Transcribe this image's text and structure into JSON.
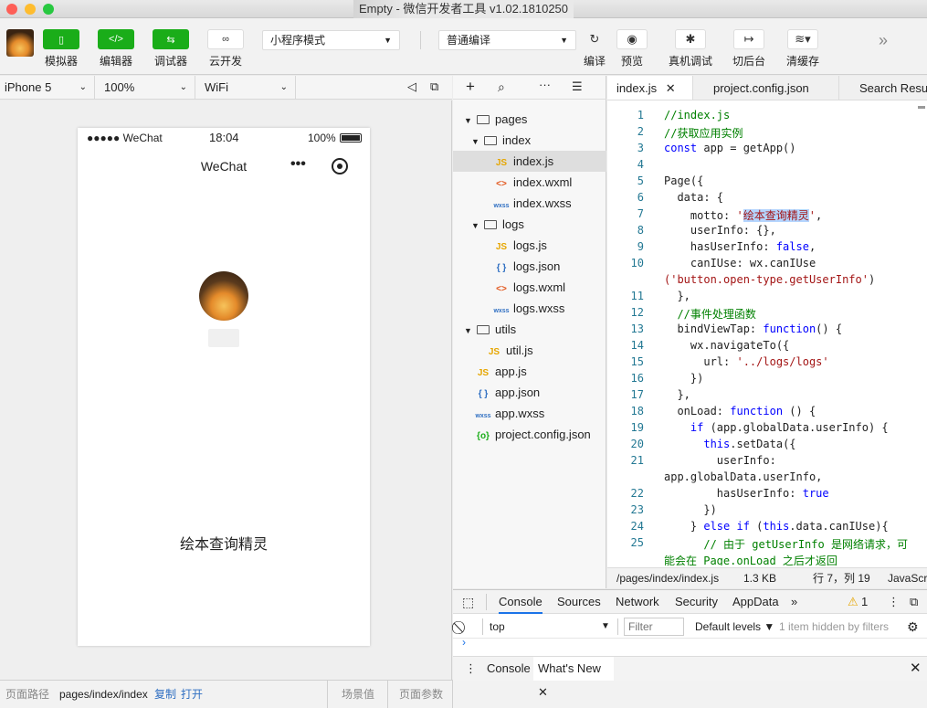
{
  "window": {
    "title": "Empty - 微信开发者工具 v1.02.1810250"
  },
  "toolbar": {
    "simulator": "模拟器",
    "editor": "编辑器",
    "debugger": "调试器",
    "cloud": "云开发",
    "mode_select": "小程序模式",
    "compile_select": "普通编译",
    "compile": "编译",
    "preview": "预览",
    "real_debug": "真机调试",
    "background": "切后台",
    "clear_cache": "清缓存"
  },
  "simbar": {
    "device": "iPhone 5",
    "zoom": "100%",
    "network": "WiFi"
  },
  "phone": {
    "carrier": "●●●●● WeChat",
    "time": "18:04",
    "battery": "100%",
    "nav_title": "WeChat",
    "motto": "绘本查询精灵"
  },
  "bottombar": {
    "path_label": "页面路径",
    "path": "pages/index/index",
    "copy": "复制",
    "open": "打开",
    "scene": "场景值",
    "params": "页面参数"
  },
  "filetree": [
    {
      "name": "pages",
      "type": "folder",
      "depth": 0
    },
    {
      "name": "index",
      "type": "folder",
      "depth": 1
    },
    {
      "name": "index.js",
      "type": "js",
      "depth": 2,
      "selected": true
    },
    {
      "name": "index.wxml",
      "type": "wxml",
      "depth": 2
    },
    {
      "name": "index.wxss",
      "type": "wxss",
      "depth": 2
    },
    {
      "name": "logs",
      "type": "folder",
      "depth": 1
    },
    {
      "name": "logs.js",
      "type": "js",
      "depth": 2
    },
    {
      "name": "logs.json",
      "type": "json",
      "depth": 2
    },
    {
      "name": "logs.wxml",
      "type": "wxml",
      "depth": 2
    },
    {
      "name": "logs.wxss",
      "type": "wxss",
      "depth": 2
    },
    {
      "name": "utils",
      "type": "folder",
      "depth": 0
    },
    {
      "name": "util.js",
      "type": "js",
      "depth": 1
    },
    {
      "name": "app.js",
      "type": "js",
      "depth": 0
    },
    {
      "name": "app.json",
      "type": "json",
      "depth": 0
    },
    {
      "name": "app.wxss",
      "type": "wxss",
      "depth": 0
    },
    {
      "name": "project.config.json",
      "type": "cfg",
      "depth": 0
    }
  ],
  "editor": {
    "tabs": [
      "index.js",
      "project.config.json",
      "Search Results"
    ],
    "status_path": "/pages/index/index.js",
    "status_size": "1.3 KB",
    "status_pos": "行 7，列 19",
    "status_lang": "JavaScript"
  },
  "devtools": {
    "tabs": [
      "Console",
      "Sources",
      "Network",
      "Security",
      "AppData"
    ],
    "warnings": "1",
    "context": "top",
    "filter_placeholder": "Filter",
    "levels": "Default levels",
    "hidden": "1 item hidden by filters",
    "drawer_tabs": [
      "Console",
      "What's New"
    ]
  }
}
